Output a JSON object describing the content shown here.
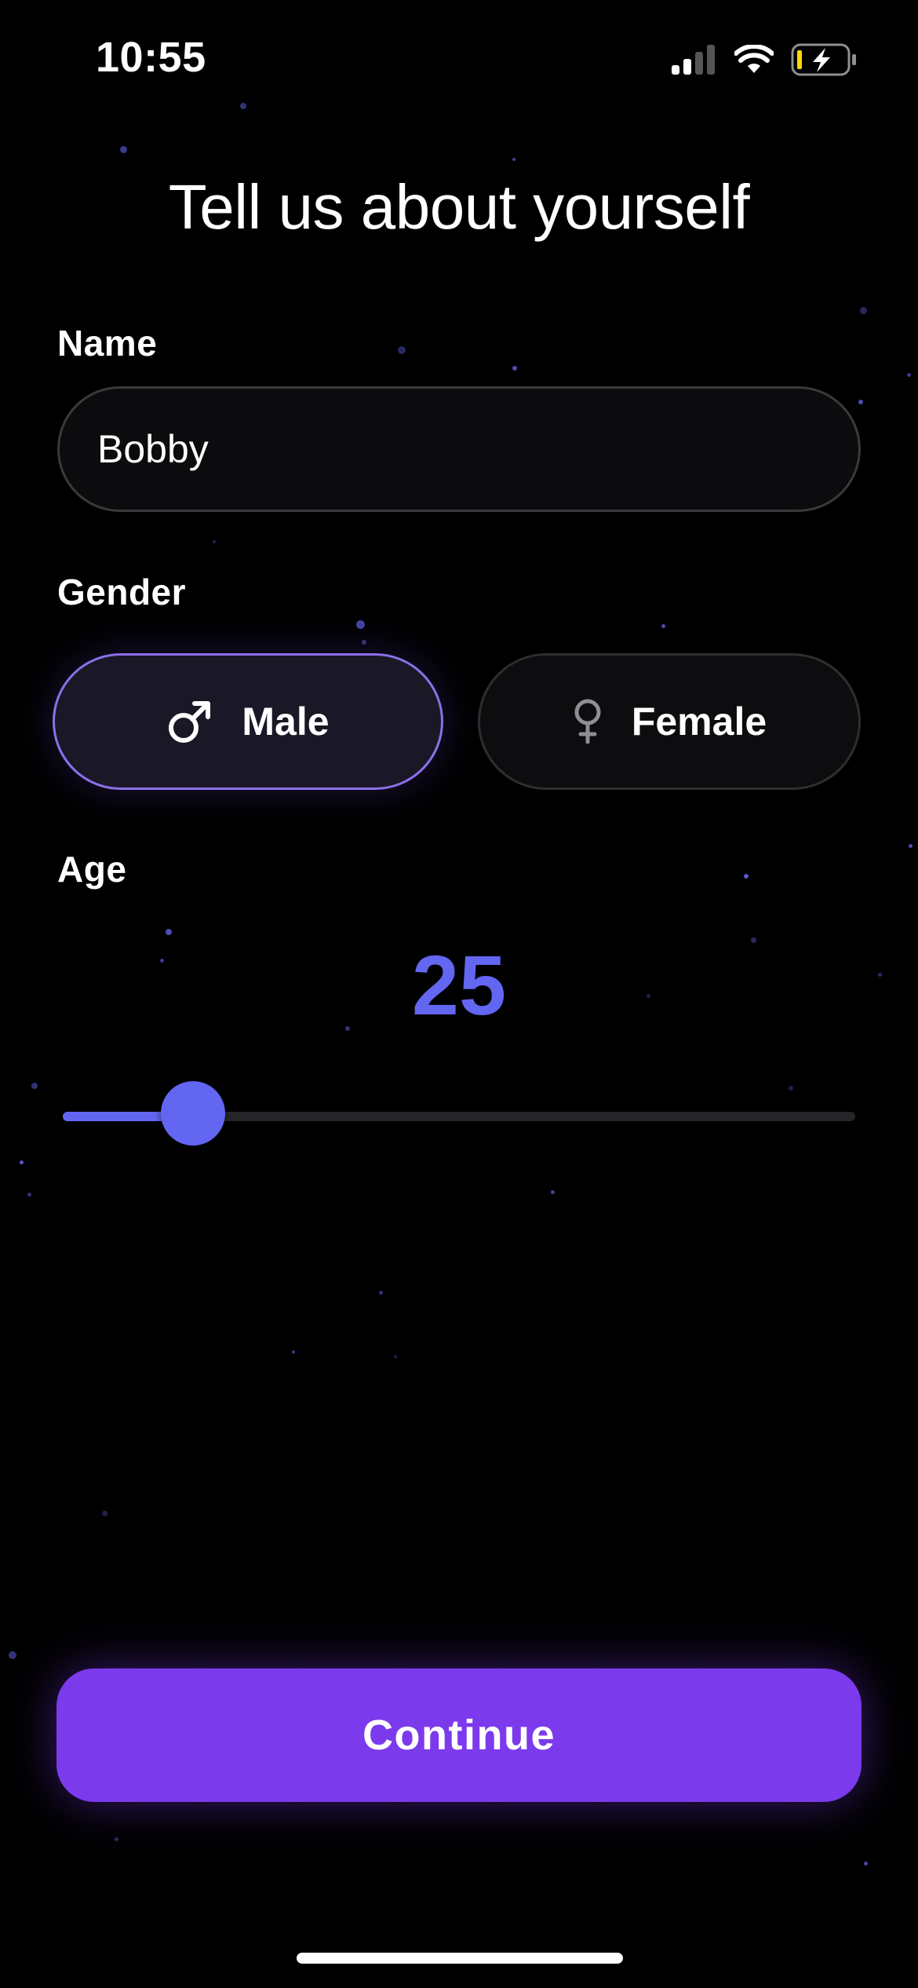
{
  "status_bar": {
    "time": "10:55",
    "signal_icon": "cellular-signal-icon",
    "wifi_icon": "wifi-icon",
    "battery_icon": "battery-charging-icon"
  },
  "form": {
    "title": "Tell us about yourself",
    "name": {
      "label": "Name",
      "value": "Bobby"
    },
    "gender": {
      "label": "Gender",
      "options": [
        {
          "label": "Male",
          "icon": "male-symbol-icon",
          "selected": true
        },
        {
          "label": "Female",
          "icon": "female-symbol-icon",
          "selected": false
        }
      ]
    },
    "age": {
      "label": "Age",
      "value": "25",
      "slider_fraction": 0.164
    }
  },
  "continue_label": "Continue",
  "colors": {
    "accent": "#6366f1",
    "button": "#7c3aed",
    "selected_border": "#8b6fe8"
  }
}
